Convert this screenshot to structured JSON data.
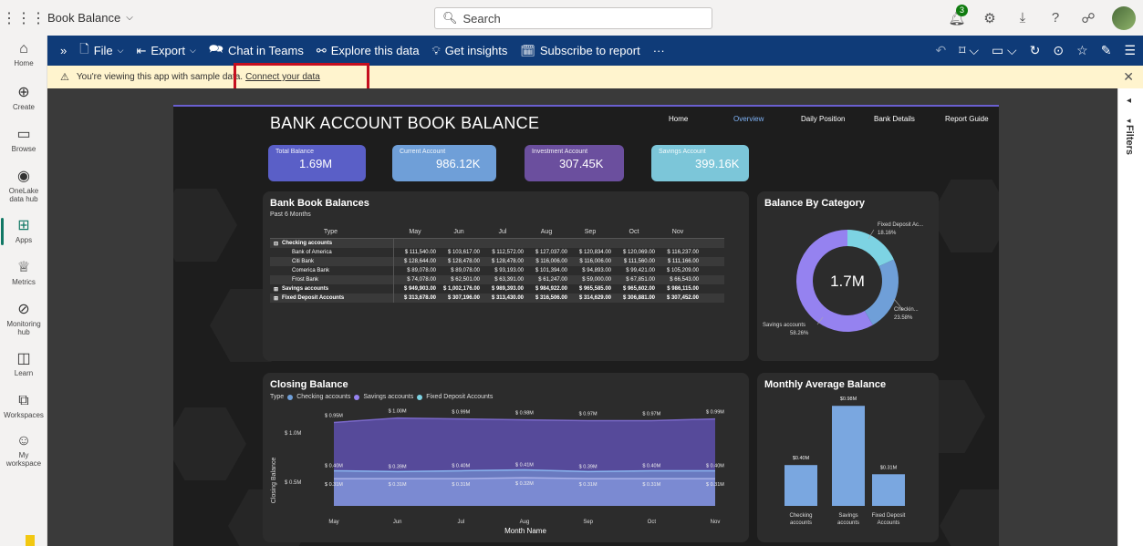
{
  "header": {
    "app_name": "Book Balance",
    "search_placeholder": "Search",
    "notification_count": "3"
  },
  "leftnav": {
    "items": [
      {
        "label": "Home",
        "icon": "home-icon"
      },
      {
        "label": "Create",
        "icon": "plus-circle-icon"
      },
      {
        "label": "Browse",
        "icon": "folder-icon"
      },
      {
        "label": "OneLake data hub",
        "icon": "onelake-icon"
      },
      {
        "label": "Apps",
        "icon": "apps-icon"
      },
      {
        "label": "Metrics",
        "icon": "trophy-icon"
      },
      {
        "label": "Monitoring hub",
        "icon": "monitor-icon"
      },
      {
        "label": "Learn",
        "icon": "book-icon"
      },
      {
        "label": "Workspaces",
        "icon": "workspaces-icon"
      },
      {
        "label": "My workspace",
        "icon": "avatar-icon"
      }
    ]
  },
  "toolbar": {
    "file": "File",
    "export": "Export",
    "chat": "Chat in Teams",
    "explore": "Explore this data",
    "insights": "Get insights",
    "subscribe": "Subscribe to report",
    "more": "···"
  },
  "banner": {
    "message": "You're viewing this app with sample data.",
    "link": "Connect your data"
  },
  "filters": {
    "label": "Filters"
  },
  "report": {
    "title": "BANK ACCOUNT BOOK BALANCE",
    "nav": [
      "Home",
      "Overview",
      "Daily Position",
      "Bank Details",
      "Report Guide"
    ],
    "kpis": [
      {
        "label": "Total Balance",
        "value": "1.69M",
        "color": "#5a5fc7"
      },
      {
        "label": "Current Account",
        "value": "986.12K",
        "color": "#6f9fd8"
      },
      {
        "label": "Investment Account",
        "value": "307.45K",
        "color": "#6b4f9e"
      },
      {
        "label": "Savings Account",
        "value": "399.16K",
        "color": "#7cc6d9"
      }
    ],
    "bank_book": {
      "title": "Bank Book Balances",
      "subtitle": "Past 6 Months",
      "columns": [
        "Type",
        "May",
        "Jun",
        "Jul",
        "Aug",
        "Sep",
        "Oct",
        "Nov"
      ],
      "rows": [
        {
          "name": "Checking accounts",
          "level": 0,
          "toggle": "⊟",
          "values": [
            "",
            "",
            "",
            "",
            "",
            "",
            ""
          ]
        },
        {
          "name": "Bank of America",
          "level": 1,
          "toggle": "",
          "values": [
            "$ 111,540.00",
            "$ 103,617.00",
            "$ 112,572.00",
            "$ 127,037.00",
            "$ 120,834.00",
            "$ 120,069.00",
            "$ 116,237.00"
          ]
        },
        {
          "name": "Citi Bank",
          "level": 1,
          "toggle": "",
          "values": [
            "$ 128,644.00",
            "$ 128,478.00",
            "$ 128,478.00",
            "$ 116,006.00",
            "$ 116,006.00",
            "$ 111,560.00",
            "$ 111,166.00"
          ]
        },
        {
          "name": "Comerica Bank",
          "level": 1,
          "toggle": "",
          "values": [
            "$ 89,078.00",
            "$ 89,078.00",
            "$ 93,193.00",
            "$ 101,394.00",
            "$ 94,893.00",
            "$ 99,421.00",
            "$ 105,209.00"
          ]
        },
        {
          "name": "Frost Bank",
          "level": 1,
          "toggle": "",
          "values": [
            "$ 74,078.00",
            "$ 62,501.00",
            "$ 63,391.00",
            "$ 61,247.00",
            "$ 59,000.00",
            "$ 67,851.00",
            "$ 66,543.00"
          ]
        },
        {
          "name": "Savings accounts",
          "level": 0,
          "toggle": "⊞",
          "values": [
            "$ 949,903.00",
            "$ 1,002,176.00",
            "$ 989,393.00",
            "$ 984,922.00",
            "$ 965,585.00",
            "$ 965,602.00",
            "$ 986,115.00"
          ]
        },
        {
          "name": "Fixed Deposit Accounts",
          "level": 0,
          "toggle": "⊞",
          "values": [
            "$ 313,678.00",
            "$ 307,196.00",
            "$ 313,430.00",
            "$ 316,506.00",
            "$ 314,629.00",
            "$ 306,881.00",
            "$ 307,452.00"
          ]
        }
      ]
    },
    "balance_by_category": {
      "title": "Balance By Category",
      "center_label": "1.7M",
      "slices": [
        {
          "label": "Fixed Deposit Ac...",
          "pct_label": "18.16%",
          "value": 18.16,
          "color": "#7dd3e3"
        },
        {
          "label": "Checkin...",
          "pct_label": "23.58%",
          "value": 23.58,
          "color": "#6f9fd8"
        },
        {
          "label": "Savings accounts",
          "pct_label": "58.26%",
          "value": 58.26,
          "color": "#9582f0"
        }
      ]
    },
    "closing_balance": {
      "title": "Closing Balance",
      "legend_title": "Type",
      "series": [
        {
          "name": "Checking accounts",
          "color": "#6f9fd8"
        },
        {
          "name": "Savings accounts",
          "color": "#9582f0"
        },
        {
          "name": "Fixed Deposit Accounts",
          "color": "#7dd3e3"
        }
      ],
      "ylabel": "Closing Balance",
      "xlabel": "Month Name",
      "yticks": [
        "$ 1.0M",
        "$ 0.5M"
      ],
      "months": [
        "May",
        "Jun",
        "Jul",
        "Aug",
        "Sep",
        "Oct",
        "Nov"
      ],
      "savings_labels": [
        "$ 0.95M",
        "$ 1.00M",
        "$ 0.99M",
        "$ 0.98M",
        "$ 0.97M",
        "$ 0.97M",
        "$ 0.99M"
      ],
      "checking_labels": [
        "$ 0.40M",
        "$ 0.39M",
        "$ 0.40M",
        "$ 0.41M",
        "$ 0.39M",
        "$ 0.40M",
        "$ 0.40M"
      ],
      "fixed_labels": [
        "$ 0.31M",
        "$ 0.31M",
        "$ 0.31M",
        "$ 0.32M",
        "$ 0.31M",
        "$ 0.31M",
        "$ 0.31M"
      ]
    },
    "monthly_average": {
      "title": "Monthly Average Balance",
      "bars": [
        {
          "category": "Checking accounts",
          "label": "$0.40M",
          "value": 0.4
        },
        {
          "category": "Savings accounts",
          "label": "$0.98M",
          "value": 0.98
        },
        {
          "category": "Fixed Deposit Accounts",
          "label": "$0.31M",
          "value": 0.31
        }
      ]
    }
  },
  "chart_data": [
    {
      "type": "pie",
      "title": "Balance By Category",
      "categories": [
        "Fixed Deposit Accounts",
        "Checking accounts",
        "Savings accounts"
      ],
      "values": [
        18.16,
        23.58,
        58.26
      ]
    },
    {
      "type": "area",
      "title": "Closing Balance",
      "xlabel": "Month Name",
      "ylabel": "Closing Balance",
      "categories": [
        "May",
        "Jun",
        "Jul",
        "Aug",
        "Sep",
        "Oct",
        "Nov"
      ],
      "series": [
        {
          "name": "Savings accounts",
          "values": [
            0.95,
            1.0,
            0.99,
            0.98,
            0.97,
            0.97,
            0.99
          ]
        },
        {
          "name": "Checking accounts",
          "values": [
            0.4,
            0.39,
            0.4,
            0.41,
            0.39,
            0.4,
            0.4
          ]
        },
        {
          "name": "Fixed Deposit Accounts",
          "values": [
            0.31,
            0.31,
            0.31,
            0.32,
            0.31,
            0.31,
            0.31
          ]
        }
      ],
      "ylim": [
        0,
        1.1
      ]
    },
    {
      "type": "bar",
      "title": "Monthly Average Balance",
      "categories": [
        "Checking accounts",
        "Savings accounts",
        "Fixed Deposit Accounts"
      ],
      "values": [
        0.4,
        0.98,
        0.31
      ]
    }
  ]
}
